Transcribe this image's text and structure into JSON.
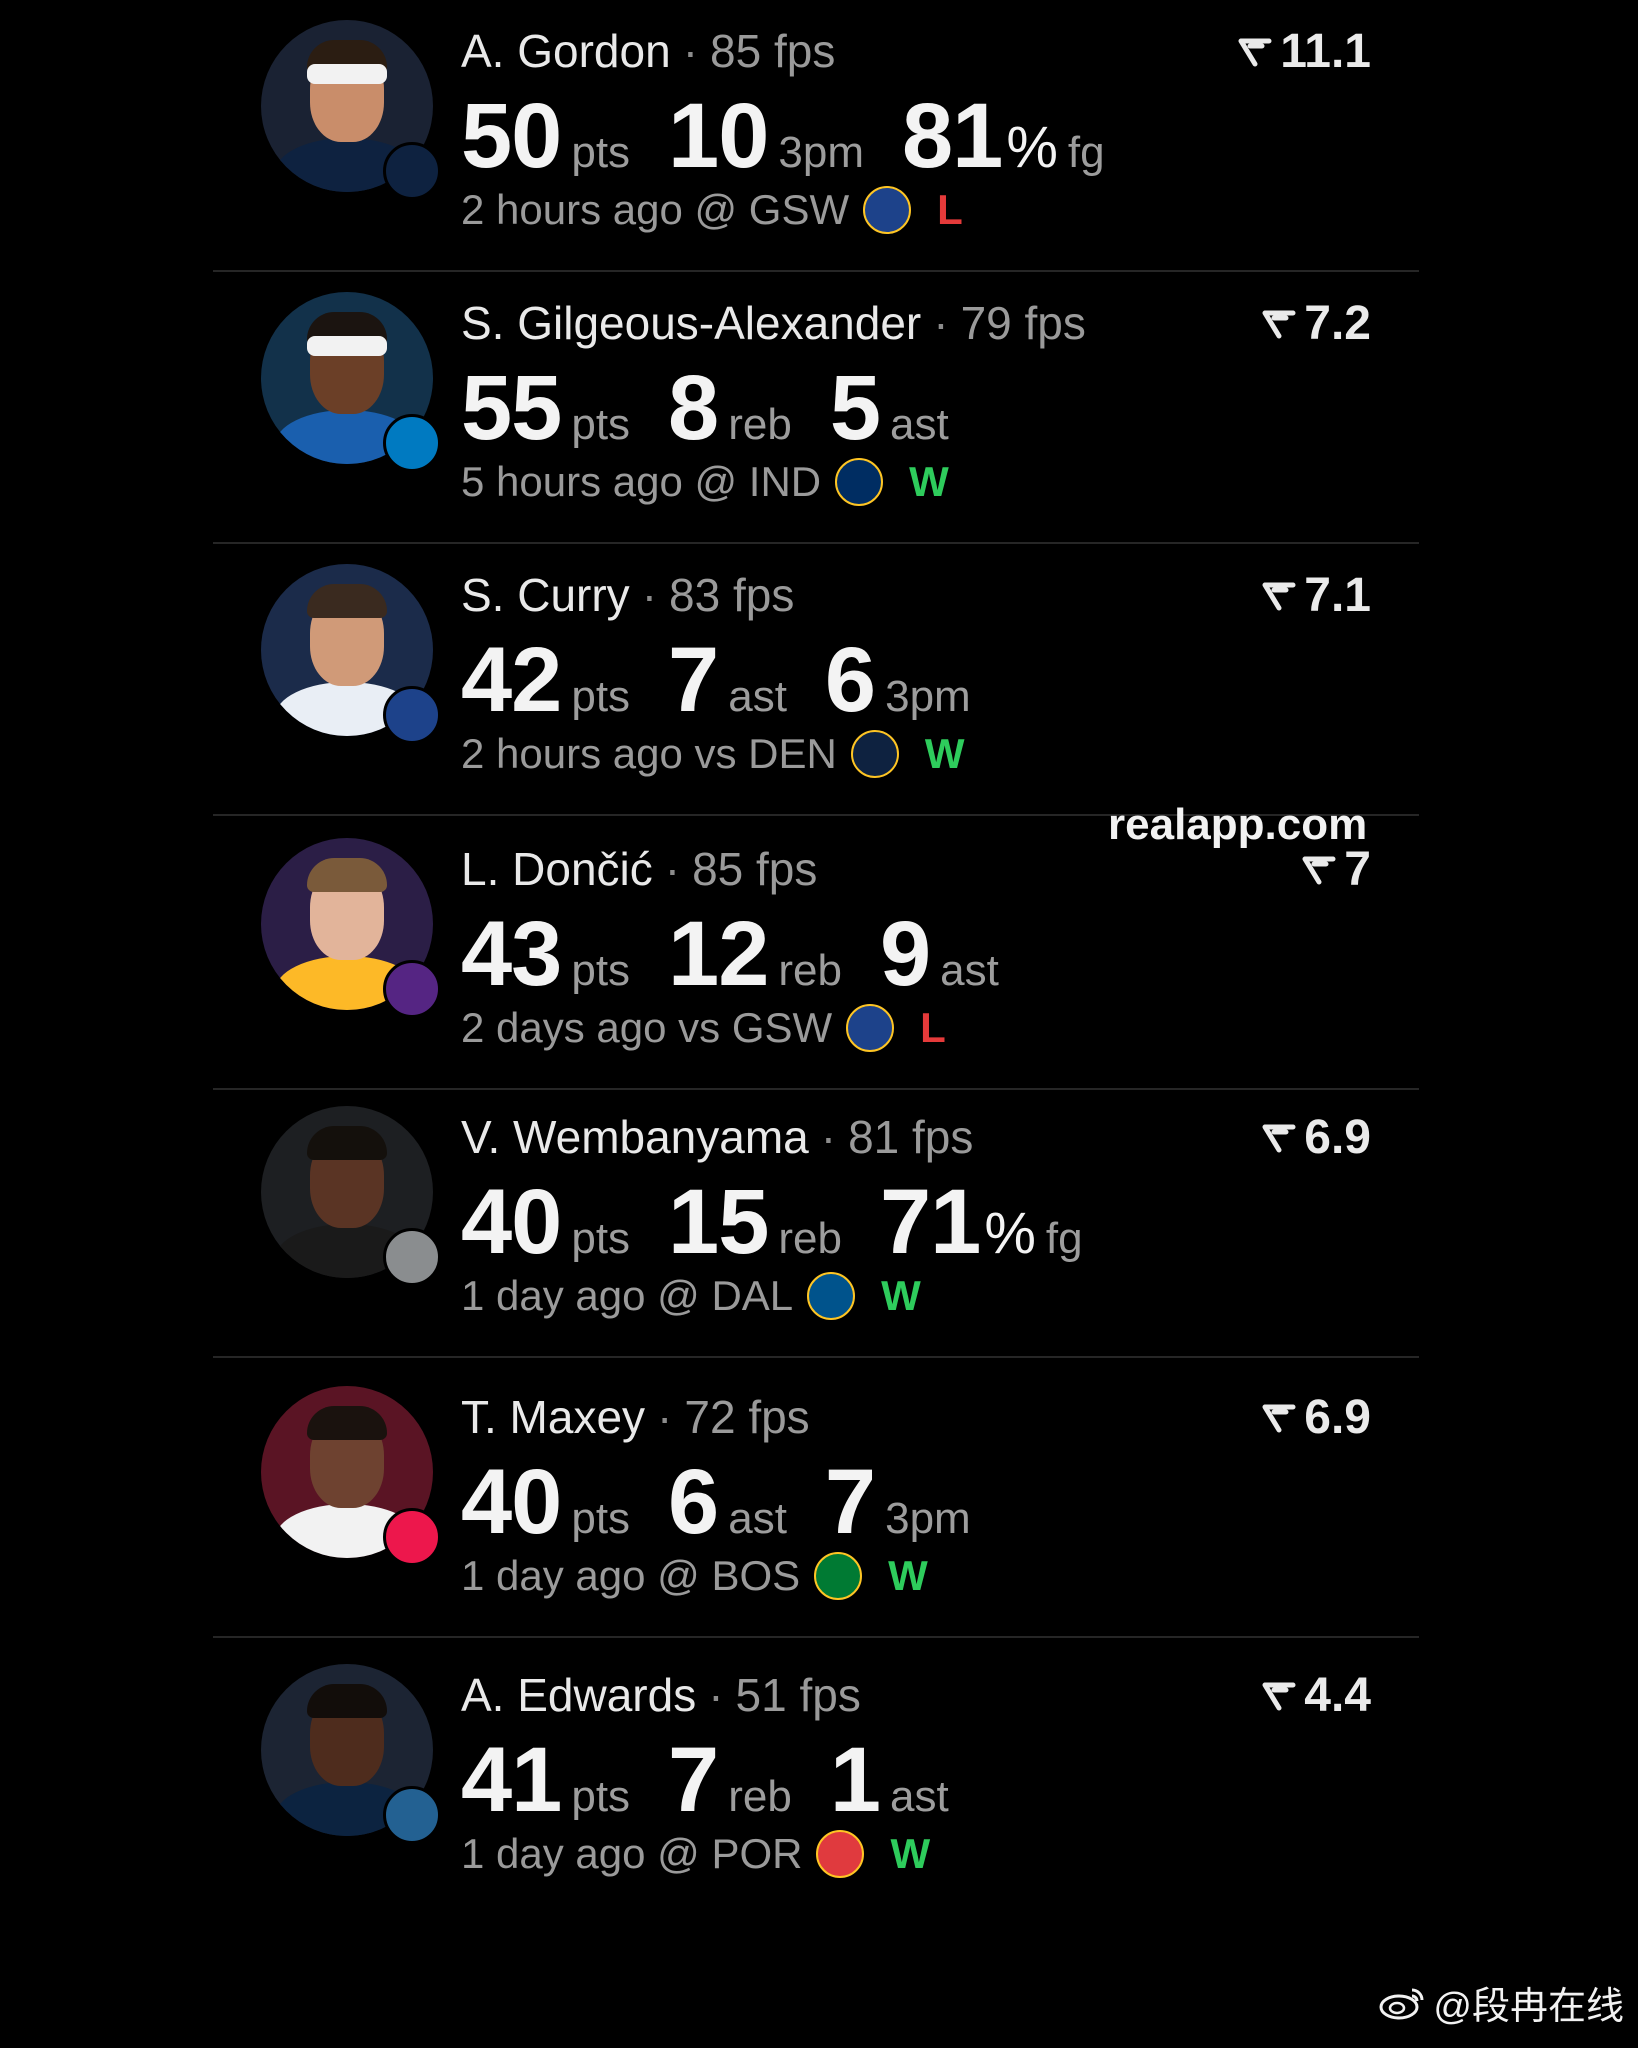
{
  "colors": {
    "background": "#000000",
    "win": "#2ecc5c",
    "loss": "#e53a3a",
    "muted": "#9a9a9a"
  },
  "watermark": "realapp.com",
  "credit": "@段冉在线",
  "players": [
    {
      "name": "A. Gordon",
      "sep": "·",
      "fps": "85 fps",
      "score": "11.1",
      "stats": [
        {
          "num": "50",
          "pct": "",
          "unit": "pts"
        },
        {
          "num": "10",
          "pct": "",
          "unit": "3pm"
        },
        {
          "num": "81",
          "pct": "%",
          "unit": "fg"
        }
      ],
      "when": "2 hours ago @ GSW",
      "opp_icon": "warriors-logo-icon",
      "result": "L",
      "team_icon": "nuggets-logo-icon",
      "team_color": "#0e2240",
      "bg": "#1a2233",
      "jersey": "#0e2240",
      "skin": "#c98d6a",
      "hair": "#2b1d12",
      "band": true
    },
    {
      "name": "S. Gilgeous-Alexander",
      "sep": "·",
      "fps": "79 fps",
      "score": "7.2",
      "stats": [
        {
          "num": "55",
          "pct": "",
          "unit": "pts"
        },
        {
          "num": "8",
          "pct": "",
          "unit": "reb"
        },
        {
          "num": "5",
          "pct": "",
          "unit": "ast"
        }
      ],
      "when": "5 hours ago @ IND",
      "opp_icon": "pacers-logo-icon",
      "result": "W",
      "team_icon": "thunder-logo-icon",
      "team_color": "#007ac1",
      "bg": "#12314a",
      "jersey": "#1a5fae",
      "skin": "#6b3f27",
      "hair": "#1b1410",
      "band": true
    },
    {
      "name": "S. Curry",
      "sep": "·",
      "fps": "83 fps",
      "score": "7.1",
      "stats": [
        {
          "num": "42",
          "pct": "",
          "unit": "pts"
        },
        {
          "num": "7",
          "pct": "",
          "unit": "ast"
        },
        {
          "num": "6",
          "pct": "",
          "unit": "3pm"
        }
      ],
      "when": "2 hours ago vs DEN",
      "opp_icon": "nuggets-logo-icon",
      "result": "W",
      "team_icon": "warriors-logo-icon",
      "team_color": "#1d428a",
      "bg": "#1b2b4a",
      "jersey": "#e9eef5",
      "skin": "#d09a78",
      "hair": "#3a2a1f",
      "band": false
    },
    {
      "name": "L. Dončić",
      "sep": "·",
      "fps": "85 fps",
      "score": "7",
      "stats": [
        {
          "num": "43",
          "pct": "",
          "unit": "pts"
        },
        {
          "num": "12",
          "pct": "",
          "unit": "reb"
        },
        {
          "num": "9",
          "pct": "",
          "unit": "ast"
        }
      ],
      "when": "2 days ago vs GSW",
      "opp_icon": "warriors-logo-icon",
      "result": "L",
      "team_icon": "lakers-logo-icon",
      "team_color": "#552583",
      "bg": "#2b1e46",
      "jersey": "#fdb927",
      "skin": "#e2b49a",
      "hair": "#7a5a3a",
      "band": false
    },
    {
      "name": "V. Wembanyama",
      "sep": "·",
      "fps": "81 fps",
      "score": "6.9",
      "stats": [
        {
          "num": "40",
          "pct": "",
          "unit": "pts"
        },
        {
          "num": "15",
          "pct": "",
          "unit": "reb"
        },
        {
          "num": "71",
          "pct": "%",
          "unit": "fg"
        }
      ],
      "when": "1 day ago @ DAL",
      "opp_icon": "mavericks-logo-icon",
      "result": "W",
      "team_icon": "spurs-logo-icon",
      "team_color": "#8a8d8f",
      "bg": "#1d1f22",
      "jersey": "#1a1a1a",
      "skin": "#5a3424",
      "hair": "#14100c",
      "band": false
    },
    {
      "name": "T. Maxey",
      "sep": "·",
      "fps": "72 fps",
      "score": "6.9",
      "stats": [
        {
          "num": "40",
          "pct": "",
          "unit": "pts"
        },
        {
          "num": "6",
          "pct": "",
          "unit": "ast"
        },
        {
          "num": "7",
          "pct": "",
          "unit": "3pm"
        }
      ],
      "when": "1 day ago @ BOS",
      "opp_icon": "celtics-logo-icon",
      "result": "W",
      "team_icon": "76ers-logo-icon",
      "team_color": "#ed174c",
      "bg": "#5a1424",
      "jersey": "#f2f2f2",
      "skin": "#6e4230",
      "hair": "#1a120e",
      "band": false
    },
    {
      "name": "A. Edwards",
      "sep": "·",
      "fps": "51 fps",
      "score": "4.4",
      "stats": [
        {
          "num": "41",
          "pct": "",
          "unit": "pts"
        },
        {
          "num": "7",
          "pct": "",
          "unit": "reb"
        },
        {
          "num": "1",
          "pct": "",
          "unit": "ast"
        }
      ],
      "when": "1 day ago @ POR",
      "opp_icon": "blazers-logo-icon",
      "result": "W",
      "team_icon": "timberwolves-logo-icon",
      "team_color": "#236192",
      "bg": "#1c2433",
      "jersey": "#0c2340",
      "skin": "#4e2c1d",
      "hair": "#120d0a",
      "band": false
    }
  ]
}
